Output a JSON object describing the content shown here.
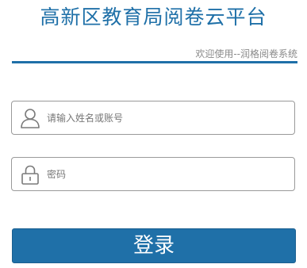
{
  "header": {
    "title": "高新区教育局阅卷云平台",
    "subtitle": "欢迎使用--润格阅卷系统"
  },
  "form": {
    "username": {
      "placeholder": "请输入姓名或账号",
      "value": "",
      "icon": "user-icon"
    },
    "password": {
      "placeholder": "密码",
      "value": "",
      "icon": "lock-icon"
    },
    "login_label": "登录"
  },
  "colors": {
    "accent": "#1f70a8",
    "border": "#9a9a9a",
    "subtitle": "#8a8a8a"
  }
}
